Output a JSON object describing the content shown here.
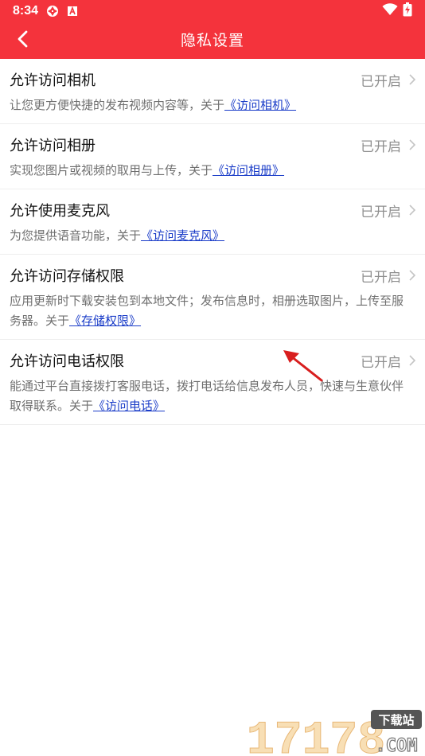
{
  "status_bar": {
    "time": "8:34",
    "app_icons": [
      "aperture-icon",
      "font-app-icon"
    ],
    "right_icons": [
      "wifi-icon",
      "battery-charging-icon"
    ]
  },
  "header": {
    "title": "隐私设置",
    "back_icon": "chevron-left-icon",
    "bg_color": "#f4333c"
  },
  "items": [
    {
      "title": "允许访问相机",
      "status": "已开启",
      "desc_text": "让您更方便快捷的发布视频内容等，关于",
      "link": "《访问相机》"
    },
    {
      "title": "允许访问相册",
      "status": "已开启",
      "desc_text": "实现您图片或视频的取用与上传，关于",
      "link": "《访问相册》"
    },
    {
      "title": "允许使用麦克风",
      "status": "已开启",
      "desc_text": "为您提供语音功能，关于",
      "link": "《访问麦克风》"
    },
    {
      "title": "允许访问存储权限",
      "status": "已开启",
      "desc_text": "应用更新时下载安装包到本地文件；发布信息时，相册选取图片，上传至服务器。关于",
      "link": "《存储权限》"
    },
    {
      "title": "允许访问电话权限",
      "status": "已开启",
      "desc_text": "能通过平台直接拨打客服电话，拨打电话给信息发布人员，快速与生意伙伴取得联系。关于",
      "link": "《访问电话》"
    }
  ],
  "watermark": {
    "number": "17178",
    "badge": "下载站",
    "domain": ".COM"
  }
}
